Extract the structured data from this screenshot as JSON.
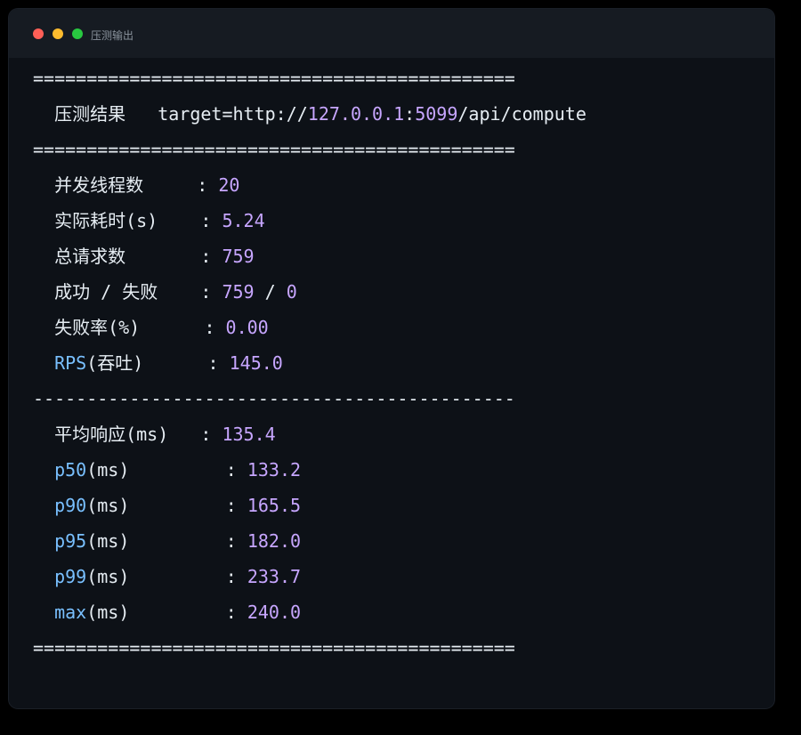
{
  "window": {
    "title": "压测输出",
    "dot_colors": {
      "red": "#ff5f57",
      "yellow": "#febc2e",
      "green": "#28c840"
    }
  },
  "colors": {
    "background": "#0d1117",
    "titlebar": "#161b22",
    "text": "#e6edf3",
    "number": "#c7a6ff",
    "keyword": "#79c0ff"
  },
  "output": {
    "rule_double": "=============================================",
    "rule_single": "---------------------------------------------",
    "header": {
      "label": "  压测结果   target=http://",
      "host": "127.0.0.1",
      "colon": ":",
      "port": "5099",
      "path": "/api/compute"
    },
    "summary": [
      {
        "label": "  并发线程数     : ",
        "value": "20"
      },
      {
        "label": "  实际耗时(s)    : ",
        "value": "5.24"
      },
      {
        "label": "  总请求数       : ",
        "value": "759"
      },
      {
        "label": "  成功 / 失败    : ",
        "value": "759",
        "sep": " / ",
        "value2": "0"
      },
      {
        "label": "  失败率(%)      : ",
        "value": "0.00"
      },
      {
        "key": "  RPS",
        "label": "(吞吐)      : ",
        "value": "145.0"
      }
    ],
    "latency": [
      {
        "label": "  平均响应(ms)   : ",
        "value": "135.4"
      },
      {
        "key": "  p50",
        "label": "(ms)         : ",
        "value": "133.2"
      },
      {
        "key": "  p90",
        "label": "(ms)         : ",
        "value": "165.5"
      },
      {
        "key": "  p95",
        "label": "(ms)         : ",
        "value": "182.0"
      },
      {
        "key": "  p99",
        "label": "(ms)         : ",
        "value": "233.7"
      },
      {
        "key": "  max",
        "label": "(ms)         : ",
        "value": "240.0"
      }
    ]
  }
}
